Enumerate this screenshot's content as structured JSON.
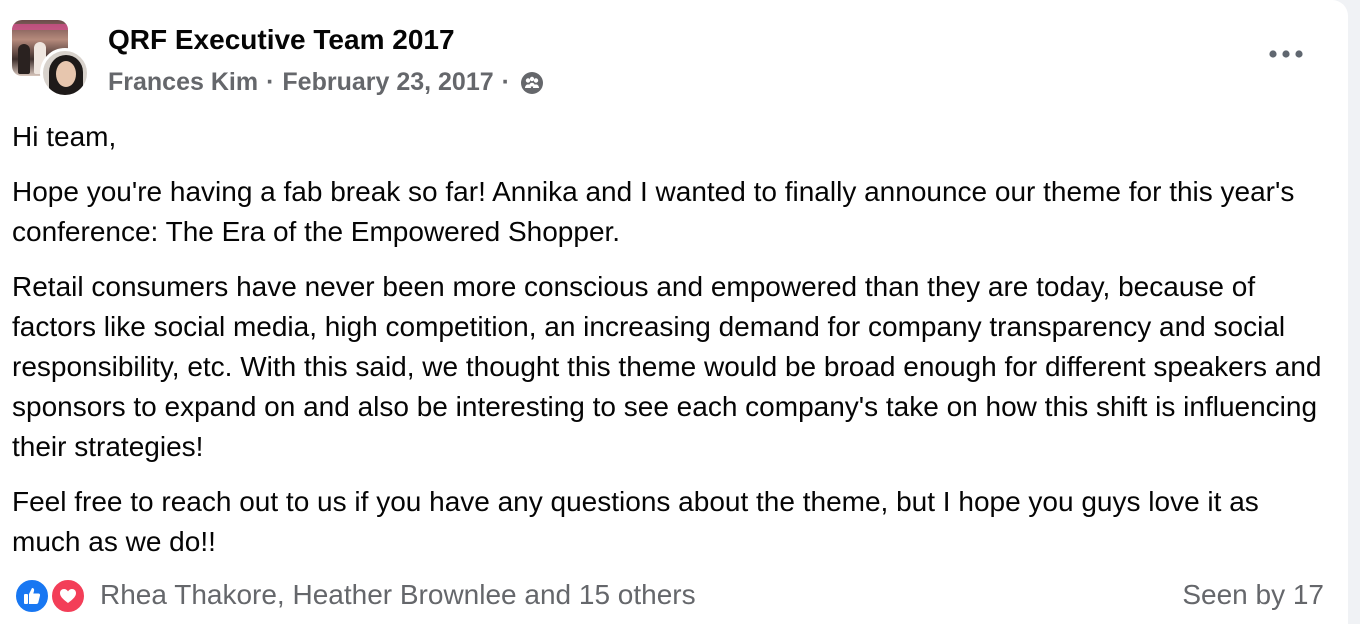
{
  "post": {
    "group_name": "QRF Executive Team 2017",
    "author": "Frances Kim",
    "separator": "·",
    "date": "February 23, 2017",
    "privacy_icon": "members-icon",
    "more_icon": "more-horizontal-icon",
    "paragraphs": [
      "Hi team,",
      "Hope you're having a fab break so far! Annika and I wanted to finally announce our theme for this year's conference: The Era of the Empowered Shopper.",
      "Retail consumers have never been more conscious and empowered than they are today, because of factors like social media, high competition, an increasing demand for company transparency and social responsibility, etc. With this said, we thought this theme would be broad enough for different speakers and sponsors to expand on and also be interesting to see each company's take on how this shift is influencing their strategies!",
      "Feel free to reach out to us if you have any questions about the theme, but I hope you guys love it as much as we do!!"
    ]
  },
  "footer": {
    "reaction_icons": [
      "like-icon",
      "love-icon"
    ],
    "reactors_text": "Rhea Thakore, Heather Brownlee and 15 others",
    "seen_text": "Seen by 17"
  },
  "colors": {
    "text_primary": "#050505",
    "text_secondary": "#65676b",
    "like_blue": "#1877f2",
    "love_red": "#f33e58"
  }
}
